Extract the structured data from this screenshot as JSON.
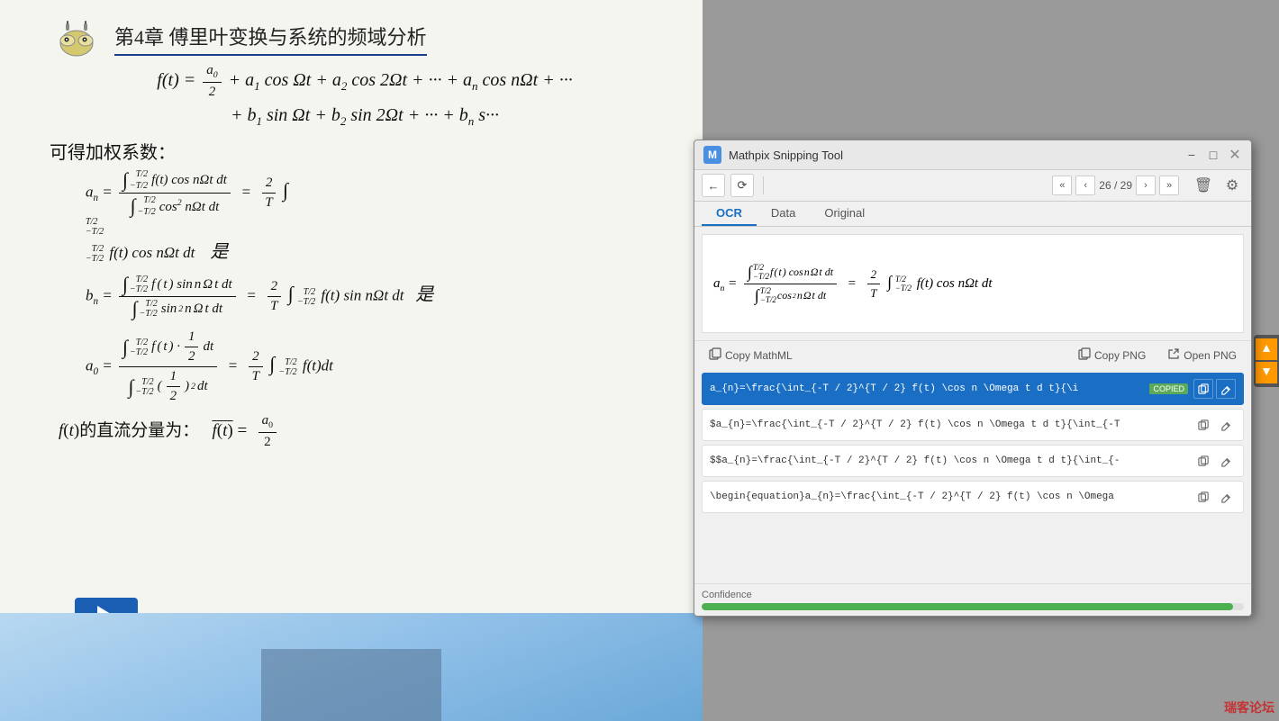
{
  "slide": {
    "chapter_title": "第4章  傅里叶变换与系统的频域分析",
    "chinese_text_1": "可得加权系数：",
    "chinese_partial_1": "是",
    "chinese_partial_2": "是"
  },
  "mathpix": {
    "window_title": "Mathpix Snipping Tool",
    "window_icon": "M",
    "tabs": [
      "OCR",
      "Data",
      "Original"
    ],
    "active_tab": "OCR",
    "page_current": "26",
    "page_total": "29",
    "actions": {
      "copy_mathml": "Copy MathML",
      "copy_png": "Copy PNG",
      "open_png": "Open PNG"
    },
    "results": [
      {
        "id": 0,
        "text": "a_{n}=\\frac{\\int_{-T / 2}^{T / 2} f(t) \\cos n \\Omega t d t}{\\i",
        "highlighted": true,
        "copied": true,
        "copied_label": "COPIED"
      },
      {
        "id": 1,
        "text": "$a_{n}=\\frac{\\int_{-T / 2}^{T / 2} f(t) \\cos n \\Omega t d t}{\\int_{-T",
        "highlighted": false,
        "copied": false
      },
      {
        "id": 2,
        "text": "$$a_{n}=\\frac{\\int_{-T / 2}^{T / 2} f(t) \\cos n \\Omega t d t}{\\int_{-",
        "highlighted": false,
        "copied": false
      },
      {
        "id": 3,
        "text": "\\begin{equation}a_{n}=\\frac{\\int_{-T / 2}^{T / 2} f(t) \\cos n \\Omega",
        "highlighted": false,
        "copied": false
      }
    ],
    "confidence_label": "Confidence",
    "confidence_value": 98,
    "toolbar": {
      "back_icon": "←",
      "refresh_icon": "⟳",
      "prev_page_icon": "«",
      "prev_icon": "‹",
      "next_icon": "›",
      "next_page_icon": "»",
      "delete_icon": "🗑",
      "settings_icon": "⚙"
    }
  },
  "nav_arrows": {
    "up": "▲",
    "down": "▼"
  },
  "watermark": "瑞客论坛"
}
